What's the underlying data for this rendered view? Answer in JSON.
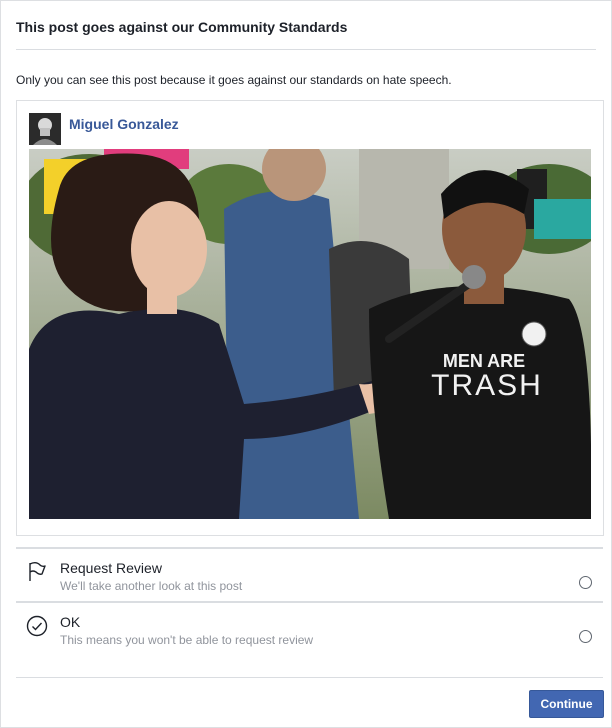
{
  "dialog": {
    "title": "This post goes against our Community Standards",
    "intro": "Only you can see this post because it goes against our standards on hate speech."
  },
  "post": {
    "author": "Miguel Gonzalez",
    "avatar_icon": "profile-photo",
    "image_shirt_text_line1": "MEN ARE",
    "image_shirt_text_line2": "TRASH"
  },
  "options": [
    {
      "title": "Request Review",
      "subtitle": "We'll take another look at this post",
      "icon": "flag-icon"
    },
    {
      "title": "OK",
      "subtitle": "This means you won't be able to request review",
      "icon": "check-circle-icon"
    }
  ],
  "footer": {
    "continue_label": "Continue"
  },
  "colors": {
    "link_blue": "#385898",
    "button_blue": "#4267b2"
  }
}
